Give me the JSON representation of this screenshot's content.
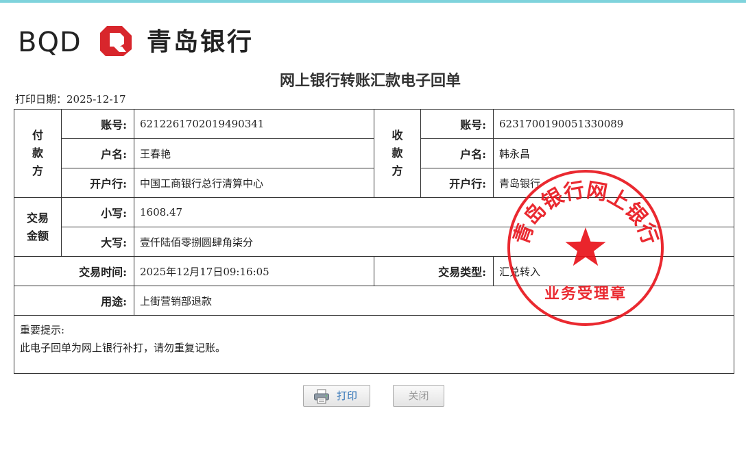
{
  "header": {
    "brand_latin": "BQD",
    "brand_cn": "青岛银行",
    "title": "网上银行转账汇款电子回单",
    "print_date_label": "打印日期：",
    "print_date": "2025-12-17"
  },
  "payer": {
    "section_label": "付款方",
    "account_label": "账号:",
    "account": "6212261702019490341",
    "name_label": "户名:",
    "name": "王春艳",
    "bank_label": "开户行:",
    "bank": "中国工商银行总行清算中心"
  },
  "payee": {
    "section_label": "收款方",
    "account_label": "账号:",
    "account": "6231700190051330089",
    "name_label": "户名:",
    "name": "韩永昌",
    "bank_label": "开户行:",
    "bank": "青岛银行"
  },
  "amount": {
    "section_label_1": "交易",
    "section_label_2": "金额",
    "lower_label": "小写:",
    "lower": "1608.47",
    "upper_label": "大写:",
    "upper": "壹仟陆佰零捌圆肆角柒分"
  },
  "transaction": {
    "time_label": "交易时间:",
    "time": "2025年12月17日09:16:05",
    "type_label": "交易类型:",
    "type": "汇兑转入",
    "purpose_label": "用途:",
    "purpose": "上街营销部退款"
  },
  "notice": {
    "heading": "重要提示:",
    "text": "此电子回单为网上银行补打，请勿重复记账。"
  },
  "seal": {
    "top_text": "青岛银行网上银行",
    "bottom_text": "业务受理章",
    "color": "#e8121a"
  },
  "buttons": {
    "print_label": "打印",
    "close_label": "关闭"
  },
  "colors": {
    "accent_bar": "#7fd3dc",
    "brand_red": "#d8262c"
  }
}
